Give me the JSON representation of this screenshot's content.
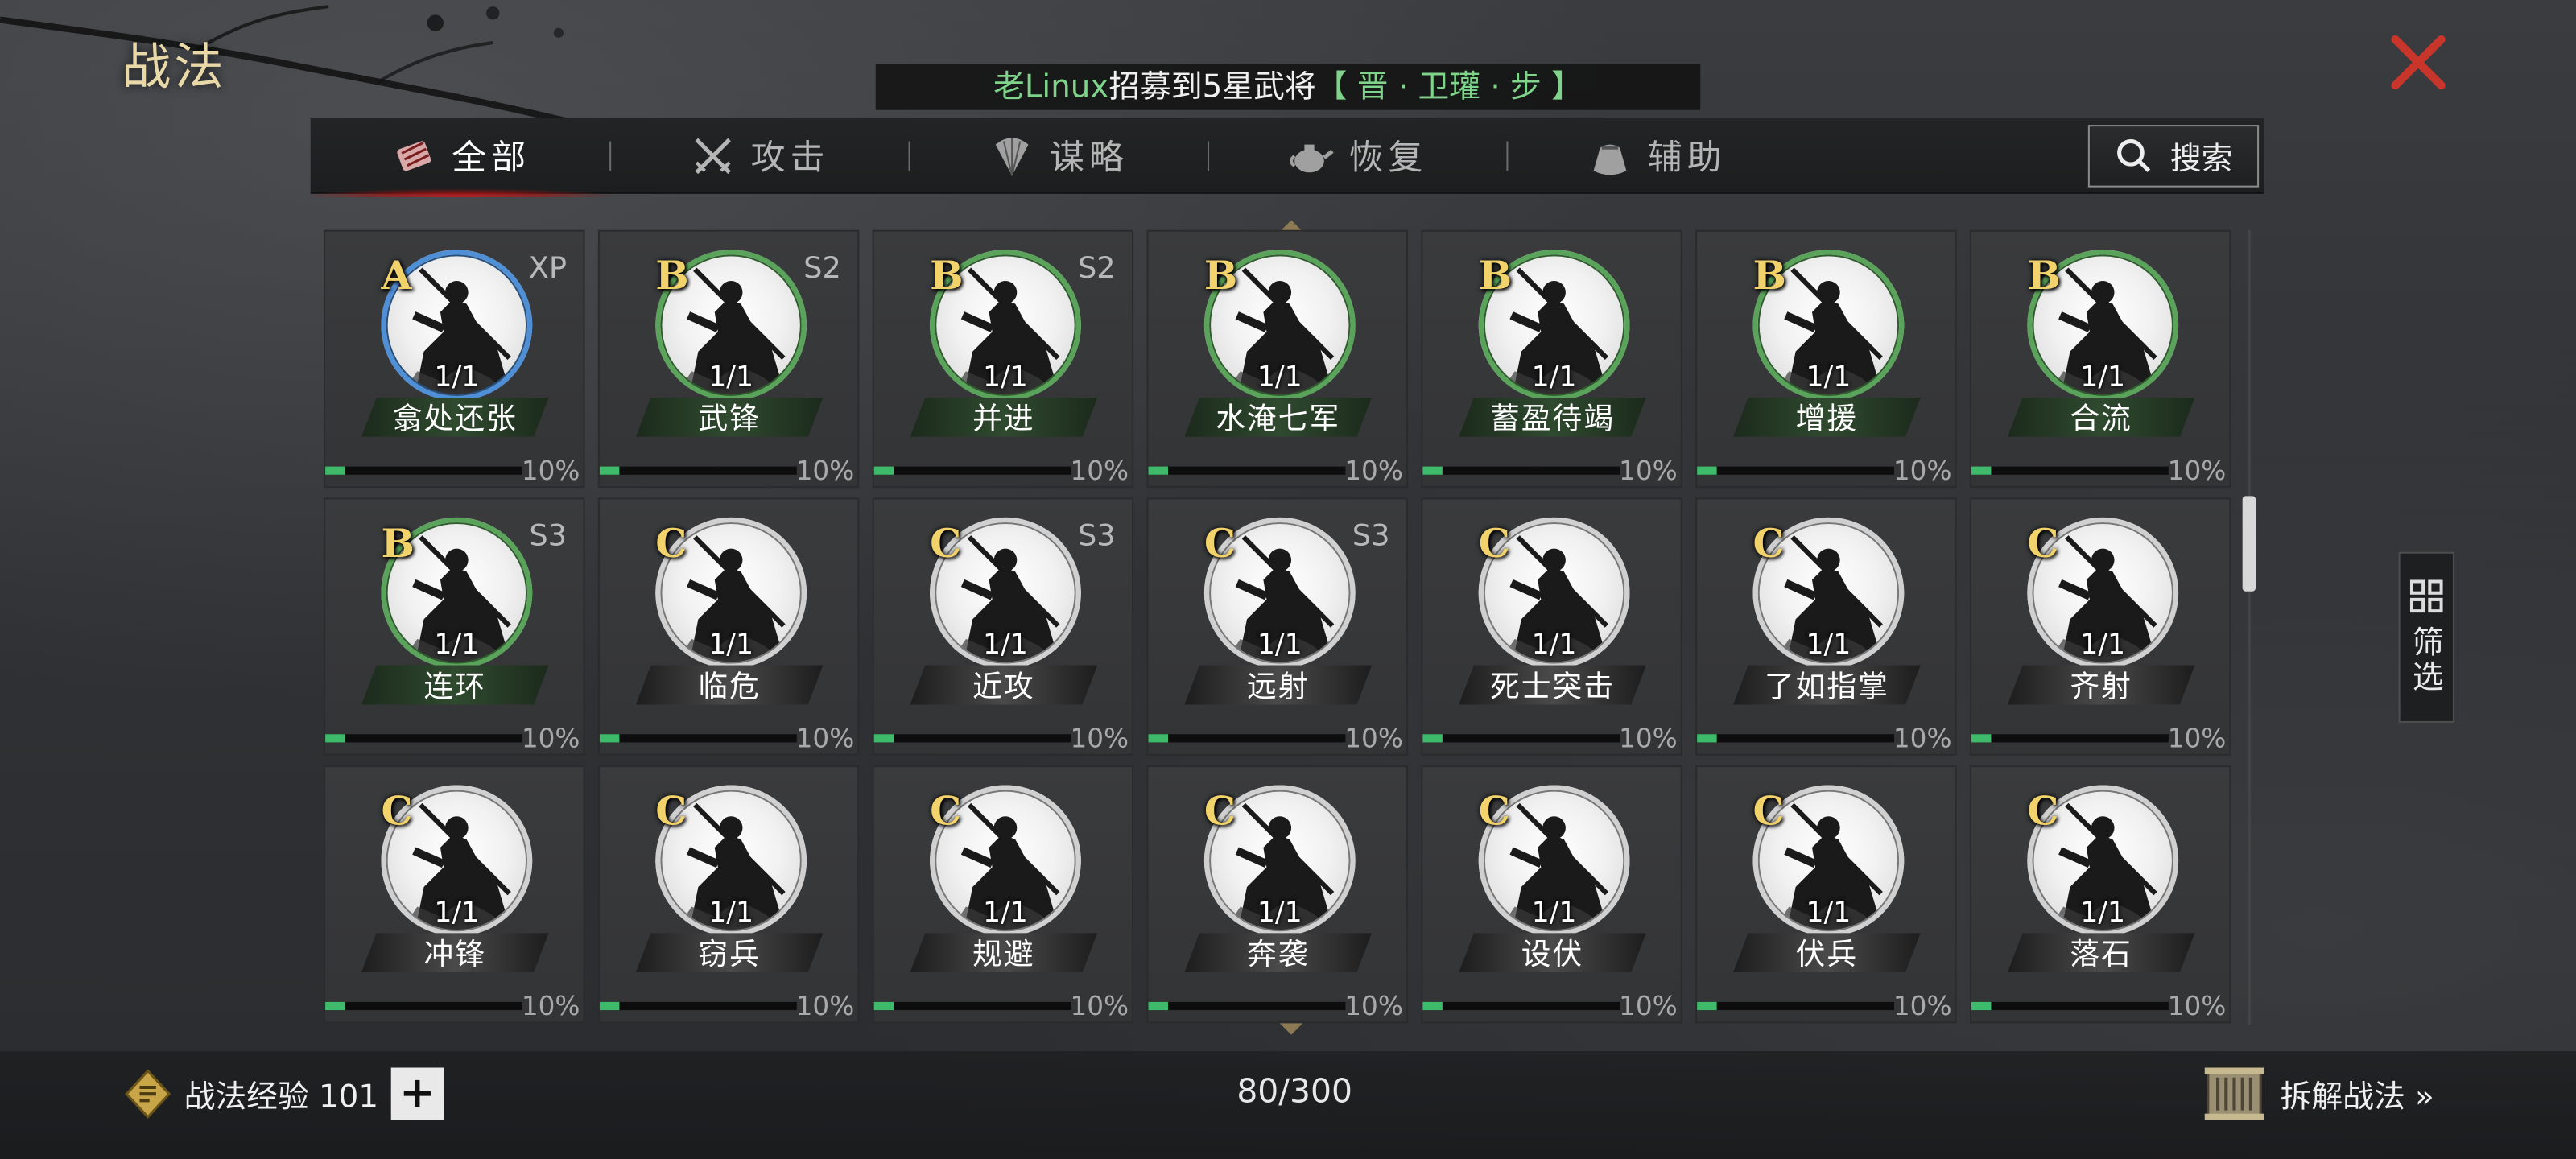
{
  "header": {
    "title": "战法",
    "ticker": {
      "player": "老Linux",
      "message": "招募到5星武将",
      "hero": "【 晋 · 卫瓘 · 步 】"
    }
  },
  "tabs": [
    {
      "label": "全部",
      "icon": "scroll-bundle-icon",
      "active": true
    },
    {
      "label": "攻击",
      "icon": "crossed-swords-icon",
      "active": false
    },
    {
      "label": "谋略",
      "icon": "feather-fan-icon",
      "active": false
    },
    {
      "label": "恢复",
      "icon": "teapot-icon",
      "active": false
    },
    {
      "label": "辅助",
      "icon": "pouch-icon",
      "active": false
    }
  ],
  "search": {
    "label": "搜索",
    "icon": "search-icon"
  },
  "filter": {
    "label": "筛选",
    "icon": "grid-icon"
  },
  "grade_colors": {
    "A": "#4f8fd6",
    "B": "#5aa35a",
    "C": "#d0d0d0"
  },
  "skills": [
    {
      "grade": "A",
      "tag": "XP",
      "count": "1/1",
      "name": "翕处还张",
      "pct_label": "10%",
      "progress": 0.1
    },
    {
      "grade": "B",
      "tag": "S2",
      "count": "1/1",
      "name": "武锋",
      "pct_label": "10%",
      "progress": 0.1
    },
    {
      "grade": "B",
      "tag": "S2",
      "count": "1/1",
      "name": "并进",
      "pct_label": "10%",
      "progress": 0.1
    },
    {
      "grade": "B",
      "tag": "",
      "count": "1/1",
      "name": "水淹七军",
      "pct_label": "10%",
      "progress": 0.1
    },
    {
      "grade": "B",
      "tag": "",
      "count": "1/1",
      "name": "蓄盈待竭",
      "pct_label": "10%",
      "progress": 0.1
    },
    {
      "grade": "B",
      "tag": "",
      "count": "1/1",
      "name": "增援",
      "pct_label": "10%",
      "progress": 0.1
    },
    {
      "grade": "B",
      "tag": "",
      "count": "1/1",
      "name": "合流",
      "pct_label": "10%",
      "progress": 0.1
    },
    {
      "grade": "B",
      "tag": "S3",
      "count": "1/1",
      "name": "连环",
      "pct_label": "10%",
      "progress": 0.1
    },
    {
      "grade": "C",
      "tag": "",
      "count": "1/1",
      "name": "临危",
      "pct_label": "10%",
      "progress": 0.1
    },
    {
      "grade": "C",
      "tag": "S3",
      "count": "1/1",
      "name": "近攻",
      "pct_label": "10%",
      "progress": 0.1
    },
    {
      "grade": "C",
      "tag": "S3",
      "count": "1/1",
      "name": "远射",
      "pct_label": "10%",
      "progress": 0.1
    },
    {
      "grade": "C",
      "tag": "",
      "count": "1/1",
      "name": "死士突击",
      "pct_label": "10%",
      "progress": 0.1
    },
    {
      "grade": "C",
      "tag": "",
      "count": "1/1",
      "name": "了如指掌",
      "pct_label": "10%",
      "progress": 0.1
    },
    {
      "grade": "C",
      "tag": "",
      "count": "1/1",
      "name": "齐射",
      "pct_label": "10%",
      "progress": 0.1
    },
    {
      "grade": "C",
      "tag": "",
      "count": "1/1",
      "name": "冲锋",
      "pct_label": "10%",
      "progress": 0.1
    },
    {
      "grade": "C",
      "tag": "",
      "count": "1/1",
      "name": "窃兵",
      "pct_label": "10%",
      "progress": 0.1
    },
    {
      "grade": "C",
      "tag": "",
      "count": "1/1",
      "name": "规避",
      "pct_label": "10%",
      "progress": 0.1
    },
    {
      "grade": "C",
      "tag": "",
      "count": "1/1",
      "name": "奔袭",
      "pct_label": "10%",
      "progress": 0.1
    },
    {
      "grade": "C",
      "tag": "",
      "count": "1/1",
      "name": "设伏",
      "pct_label": "10%",
      "progress": 0.1
    },
    {
      "grade": "C",
      "tag": "",
      "count": "1/1",
      "name": "伏兵",
      "pct_label": "10%",
      "progress": 0.1
    },
    {
      "grade": "C",
      "tag": "",
      "count": "1/1",
      "name": "落石",
      "pct_label": "10%",
      "progress": 0.1
    }
  ],
  "footer": {
    "exp_label": "战法经验 101",
    "exp_icon": "exp-token-icon",
    "plus": "+",
    "capacity": "80/300",
    "dismantle_label": "拆解战法 »",
    "dismantle_icon": "scroll-icon"
  },
  "scrollbar": {
    "position": 0.38
  }
}
